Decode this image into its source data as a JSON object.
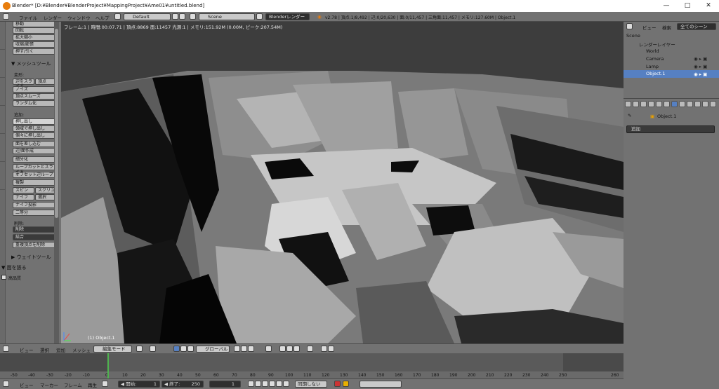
{
  "title_bar": {
    "title": "Blender* [D:¥Blender¥BlenderProject¥MappingProject¥Ame01¥untitled.blend]",
    "minimize": "—",
    "maximize": "□",
    "close": "✕"
  },
  "info_header": {
    "menus": [
      "ファイル",
      "レンダー",
      "ウィンドウ",
      "ヘルプ"
    ],
    "layout": "Default",
    "scene": "Scene",
    "engine": "Blenderレンダー",
    "stats": "v2.78 | 頂点:1/8,492 | 辺:0/20,630 | 面:0/11,457 | 三角面:11,457 | メモリ:127.60M | Object.1"
  },
  "tool_tabs": [
    "ツール",
    "作成",
    "リレーション",
    "アニメーション",
    "物理演算",
    "グリースペンシル"
  ],
  "tool_panel": {
    "transform_buttons": [
      "移動",
      "回転",
      "拡大縮小",
      "収縮/膨張",
      "押す/引く"
    ],
    "mesh_tools_header": "▼ メッシュツール",
    "deform_label": "変形:",
    "deform_buttons_row": [
      "辺をスライド",
      "頂点"
    ],
    "deform_buttons": [
      "ノイズ",
      "頂点スムーズ",
      "ランダム化"
    ],
    "add_label": "追加:",
    "add_buttons": [
      "押し出し",
      "領域で押し出し",
      "個々に押し出し",
      "面を差し込む",
      "辺/面作成",
      "細分化",
      "ループカットとスライド",
      "オフセット辺ループ",
      "複製"
    ],
    "add_pairs": [
      [
        "スピン",
        "スクリュー"
      ],
      [
        "ナイフ",
        "選択"
      ]
    ],
    "add_buttons2": [
      "ナイフ投影",
      "二等分"
    ],
    "remove_label": "削除:",
    "remove_dropdowns": [
      "削除",
      "結合"
    ],
    "remove_button": "重複頂点を削除",
    "weight_tools": "▶ ウェイトツール",
    "redo_header": "▼ 面を張る",
    "redo_checkbox": "高品質"
  },
  "viewport": {
    "header_text": "フレーム:1 | 時間:00:07.71 | 頂点:8869 面:11457 光源:1 | メモリ:151.92M (0.00M, ピーク:207.54M)",
    "object_label": "(1) Object.1"
  },
  "viewport_header": {
    "menus": [
      "ビュー",
      "選択",
      "追加",
      "メッシュ"
    ],
    "mode": "編集モード",
    "orientation": "グローバル"
  },
  "timeline": {
    "ticks": [
      "-50",
      "-40",
      "-30",
      "-20",
      "-10",
      "0",
      "10",
      "20",
      "30",
      "40",
      "50",
      "60",
      "70",
      "80",
      "90",
      "100",
      "110",
      "120",
      "130",
      "140",
      "150",
      "160",
      "170",
      "180",
      "190",
      "200",
      "210",
      "220",
      "230",
      "240",
      "250",
      "260"
    ],
    "current_frame": 1
  },
  "timeline_header": {
    "menus": [
      "ビュー",
      "マーカー",
      "フレーム",
      "再生"
    ],
    "start_label": "◀ 開始:",
    "start_value": "1",
    "end_label": "◀ 終了:",
    "end_value": "250",
    "current_value": "1",
    "sync": "同期しない"
  },
  "outliner": {
    "tabs": [
      "ビュー",
      "検索",
      "全てのシーン"
    ],
    "items": [
      "Scene",
      "レンダーレイヤー",
      "World",
      "Camera",
      "Lamp",
      "Object.1"
    ]
  },
  "properties": {
    "object_name": "Object.1",
    "add_dropdown": "追加"
  },
  "colors": {
    "panel": "#727272",
    "selection": "#5680c2",
    "playhead": "#4fb34f",
    "blender_logo": "#e87d0d"
  }
}
